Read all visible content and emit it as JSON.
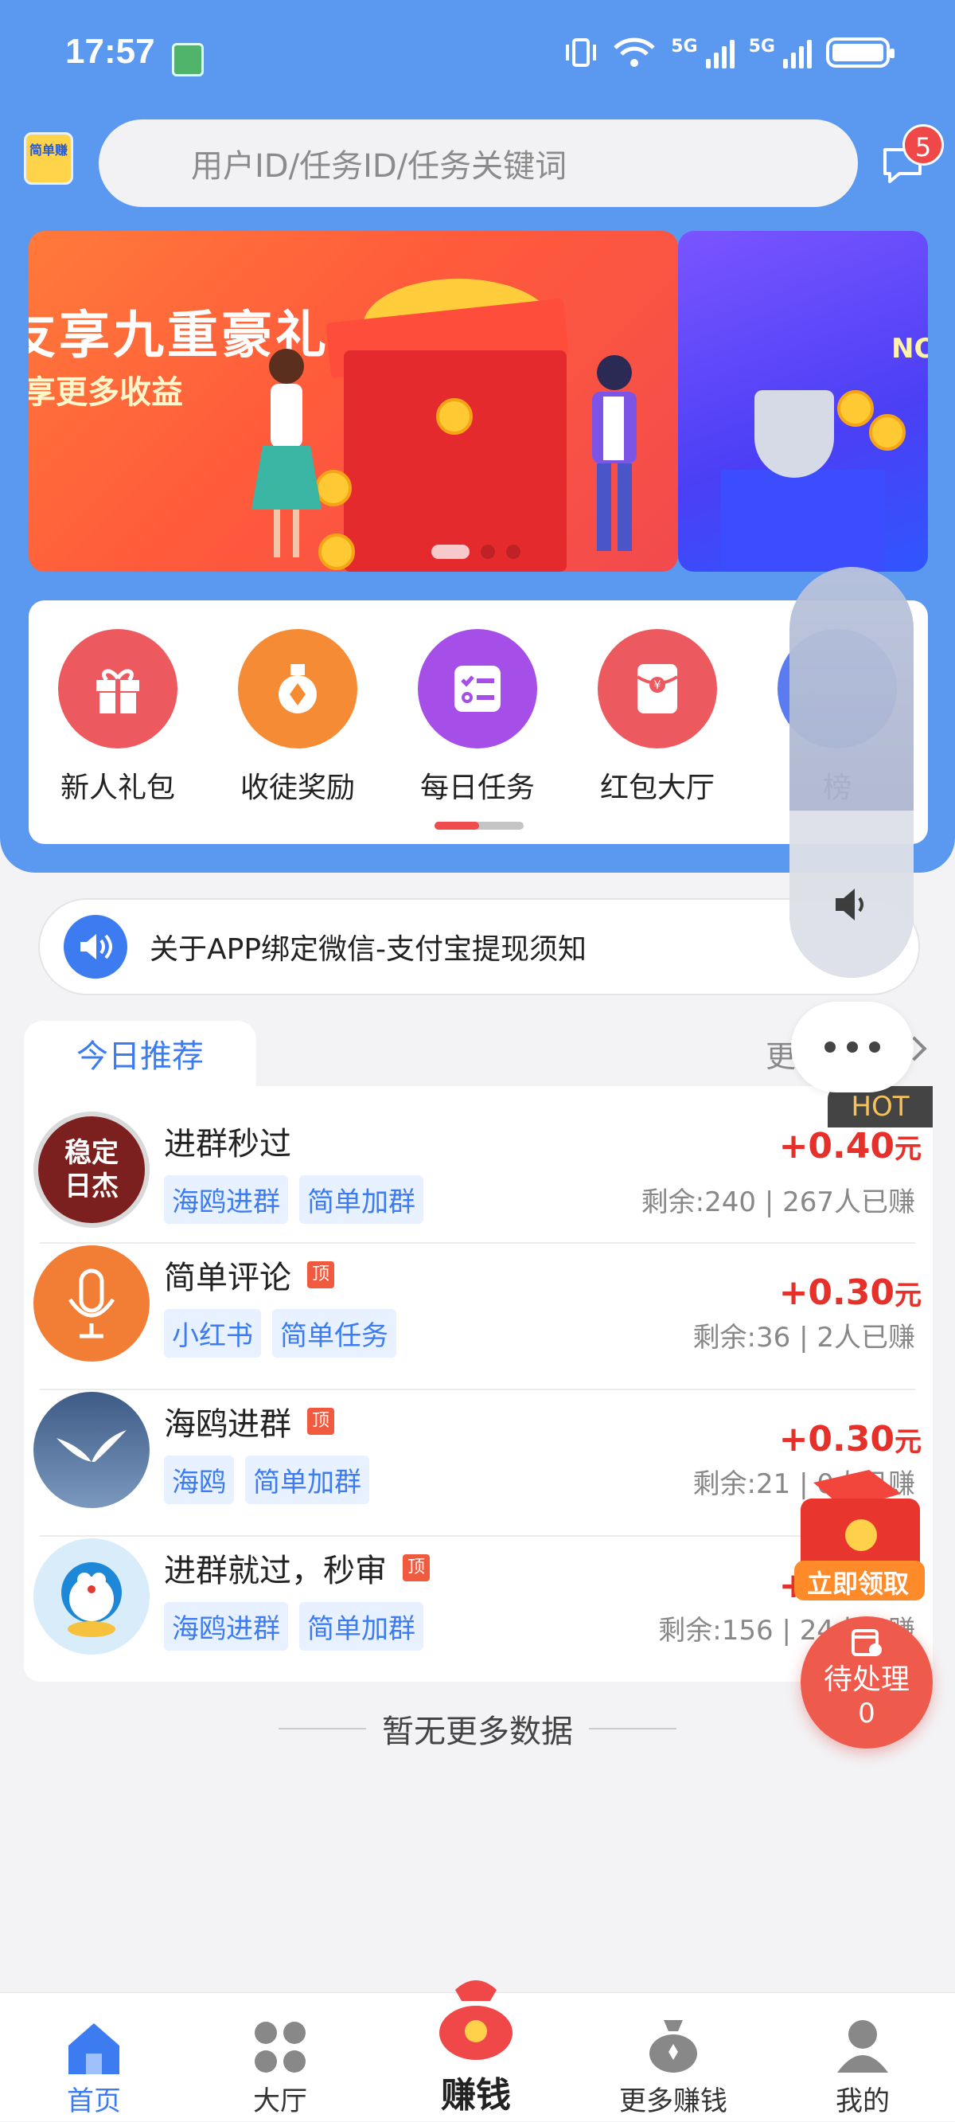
{
  "status_bar": {
    "time": "17:57",
    "net1": "5G",
    "net2": "5G",
    "wifi_tag": "6"
  },
  "header": {
    "logo_text": "简单赚",
    "search_placeholder": "用户ID/任务ID/任务关键词",
    "message_badge": "5"
  },
  "banner": {
    "title": "友享九重豪礼",
    "subtitle": "享更多收益",
    "side_text": "NO"
  },
  "categories": [
    {
      "label": "新人礼包",
      "icon": "gift-icon",
      "color": "#ec5a60"
    },
    {
      "label": "收徒奖励",
      "icon": "coin-medal-icon",
      "color": "#f58b35"
    },
    {
      "label": "每日任务",
      "icon": "checklist-icon",
      "color": "#a64fe8"
    },
    {
      "label": "红包大厅",
      "icon": "red-envelope-icon",
      "color": "#ec5a60"
    },
    {
      "label": "榜",
      "icon": "rank-icon",
      "color": "#5b7cf0"
    }
  ],
  "notice": {
    "text": "关于APP绑定微信-支付宝提现须知"
  },
  "recommend": {
    "tab_label": "今日推荐",
    "more_label": "更多",
    "hot_label": "HOT",
    "tasks": [
      {
        "title": "进群秒过",
        "pinned": false,
        "tags": [
          "海鸥进群",
          "简单加群"
        ],
        "price": "+0.40",
        "unit": "元",
        "remaining": "剩余:240",
        "earned": "267人已赚",
        "avatar_text": "稳定日杰"
      },
      {
        "title": "简单评论",
        "pinned": true,
        "tags": [
          "小红书",
          "简单任务"
        ],
        "price": "+0.30",
        "unit": "元",
        "remaining": "剩余:36",
        "earned": "2人已赚"
      },
      {
        "title": "海鸥进群",
        "pinned": true,
        "tags": [
          "海鸥",
          "简单加群"
        ],
        "price": "+0.30",
        "unit": "元",
        "remaining": "剩余:21",
        "earned": "0人已赚"
      },
      {
        "title": "进群就过，秒审",
        "pinned": true,
        "tags": [
          "海鸥进群",
          "简单加群"
        ],
        "price": "+0.30",
        "unit": "元",
        "remaining": "剩余:156",
        "earned": "24人已赚"
      }
    ],
    "pin_label": "顶",
    "no_more": "暂无更多数据"
  },
  "floating": {
    "red_packet_label": "立即领取",
    "pending_label": "待处理",
    "pending_count": "0"
  },
  "bottom_nav": [
    {
      "label": "首页",
      "icon": "home-icon",
      "active": true
    },
    {
      "label": "大厅",
      "icon": "grid-icon",
      "active": false
    },
    {
      "label": "赚钱",
      "icon": "money-bag-icon",
      "active": false
    },
    {
      "label": "更多赚钱",
      "icon": "coin-bag-icon",
      "active": false
    },
    {
      "label": "我的",
      "icon": "user-icon",
      "active": false
    }
  ],
  "colors": {
    "primary": "#5b99f1",
    "accent": "#3d7cf0",
    "price": "#e6302a",
    "pending": "#ee5a4c"
  }
}
